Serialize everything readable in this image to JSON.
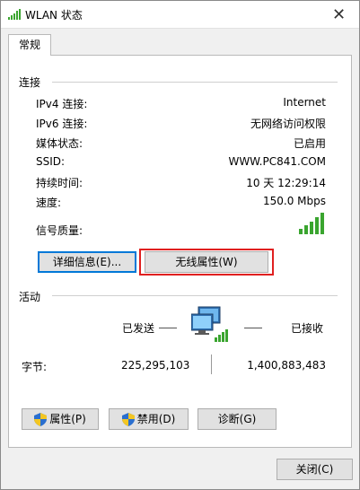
{
  "window": {
    "title": "WLAN 状态",
    "close_symbol": "✕"
  },
  "tabs": [
    {
      "label": "常规"
    }
  ],
  "connection": {
    "group_title": "连接",
    "rows": [
      {
        "label": "IPv4 连接:",
        "value": "Internet"
      },
      {
        "label": "IPv6 连接:",
        "value": "无网络访问权限"
      },
      {
        "label": "媒体状态:",
        "value": "已启用"
      },
      {
        "label": "SSID:",
        "value": "WWW.PC841.COM"
      },
      {
        "label": "持续时间:",
        "value": "10 天 12:29:14"
      },
      {
        "label": "速度:",
        "value": "150.0 Mbps"
      }
    ],
    "signal_label": "信号质量:",
    "signal_bars": 5,
    "details_button": "详细信息(E)...",
    "wireless_props_button": "无线属性(W)"
  },
  "activity": {
    "group_title": "活动",
    "sent_label": "已发送",
    "received_label": "已接收",
    "bytes_label": "字节:",
    "bytes_sent": "225,295,103",
    "bytes_received": "1,400,883,483"
  },
  "actions": {
    "properties_button": "属性(P)",
    "disable_button": "禁用(D)",
    "diagnose_button": "诊断(G)"
  },
  "footer": {
    "close_button": "关闭(C)"
  },
  "colors": {
    "accent": "#0078d7",
    "highlight": "#e02020",
    "signal": "#3aa52f"
  }
}
